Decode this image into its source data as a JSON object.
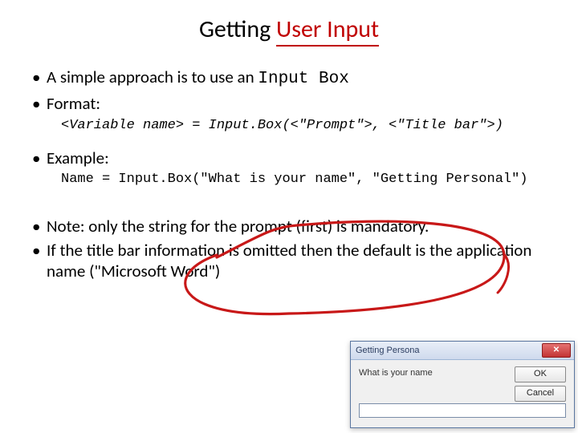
{
  "title_plain": "Getting ",
  "title_accent": "User Input",
  "bullets": {
    "b1_pre": "A simple approach is to use an ",
    "b1_mono": "Input Box",
    "b2": "Format:",
    "format_code": "<Variable name> = Input.Box(<\"Prompt\">, <\"Title bar\">)",
    "b3": "Example:",
    "example_code": "Name = Input.Box(\"What is your name\", \"Getting Personal\")",
    "b4": "Note: only the string for the prompt (first) is mandatory.",
    "b5": "If the title bar information is omitted then the default is the application name (\"Microsoft Word\")"
  },
  "dialog": {
    "title": "Getting Persona",
    "prompt": "What is your name",
    "ok": "OK",
    "cancel": "Cancel",
    "close_x": "✕",
    "input_value": ""
  }
}
